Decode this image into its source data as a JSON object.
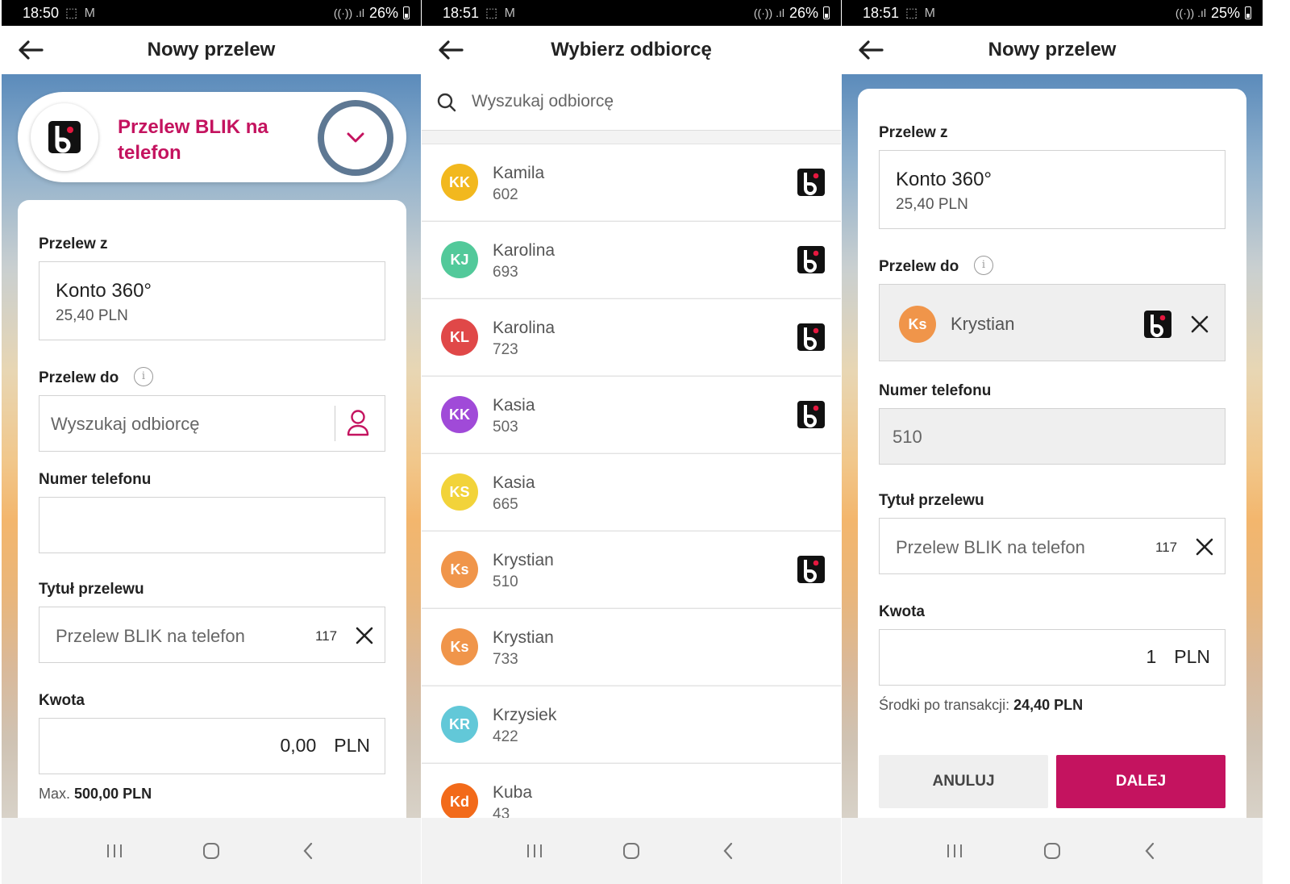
{
  "screens": [
    {
      "status": {
        "time": "18:50",
        "icons": "⬚ M",
        "battery": "26%"
      },
      "title": "Nowy przelew",
      "blik_label": "Przelew BLIK na telefon",
      "from_label": "Przelew z",
      "account_name": "Konto 360°",
      "account_balance": "25,40 PLN",
      "to_label": "Przelew do",
      "to_placeholder": "Wyszukaj odbiorcę",
      "phone_label": "Numer telefonu",
      "phone_value": "",
      "title_label": "Tytuł przelewu",
      "title_value": "Przelew BLIK na telefon",
      "title_counter": "117",
      "amount_label": "Kwota",
      "amount_value": "0,00",
      "currency": "PLN",
      "max_prefix": "Max.",
      "max_value": "500,00 PLN"
    },
    {
      "status": {
        "time": "18:51",
        "icons": "⬚ M",
        "battery": "26%"
      },
      "title": "Wybierz odbiorcę",
      "search_placeholder": "Wyszukaj odbiorcę",
      "contacts": [
        {
          "initials": "KK",
          "name": "Kamila",
          "number": "602",
          "color": "#f2b81e",
          "blik": true
        },
        {
          "initials": "KJ",
          "name": "Karolina",
          "number": "693",
          "color": "#52c99a",
          "blik": true
        },
        {
          "initials": "KL",
          "name": "Karolina",
          "number": "723",
          "color": "#e04848",
          "blik": true
        },
        {
          "initials": "KK",
          "name": "Kasia",
          "number": "503",
          "color": "#a04ad8",
          "blik": true
        },
        {
          "initials": "KS",
          "name": "Kasia",
          "number": "665",
          "color": "#f2d33a",
          "blik": false
        },
        {
          "initials": "Ks",
          "name": "Krystian",
          "number": "510",
          "color": "#f0954a",
          "blik": true
        },
        {
          "initials": "Ks",
          "name": "Krystian",
          "number": "733",
          "color": "#f0954a",
          "blik": false
        },
        {
          "initials": "KR",
          "name": "Krzysiek",
          "number": "422",
          "color": "#62c8d8",
          "blik": false
        },
        {
          "initials": "Kd",
          "name": "Kuba",
          "number": "43",
          "color": "#f26a1a",
          "blik": false
        }
      ]
    },
    {
      "status": {
        "time": "18:51",
        "icons": "⬚ M",
        "battery": "25%"
      },
      "title": "Nowy przelew",
      "from_label": "Przelew z",
      "account_name": "Konto 360°",
      "account_balance": "25,40 PLN",
      "to_label": "Przelew do",
      "recipient_initials": "Ks",
      "recipient_name": "Krystian",
      "phone_label": "Numer telefonu",
      "phone_value": "510",
      "title_label": "Tytuł przelewu",
      "title_value": "Przelew BLIK na telefon",
      "title_counter": "117",
      "amount_label": "Kwota",
      "amount_value": "1",
      "currency": "PLN",
      "funds_prefix": "Środki po transakcji:",
      "funds_value": "24,40",
      "funds_currency": "PLN",
      "cancel_label": "ANULUJ",
      "next_label": "DALEJ"
    }
  ],
  "colors": {
    "brand": "#c4135f",
    "chevron_ring": "#5e7893",
    "field_border": "#d2d2d2"
  },
  "icons": [
    "back-arrow-icon",
    "blik-logo-icon",
    "chevron-down-icon",
    "info-icon",
    "person-icon",
    "close-icon",
    "search-icon",
    "recents-icon",
    "home-icon",
    "nav-back-icon"
  ]
}
